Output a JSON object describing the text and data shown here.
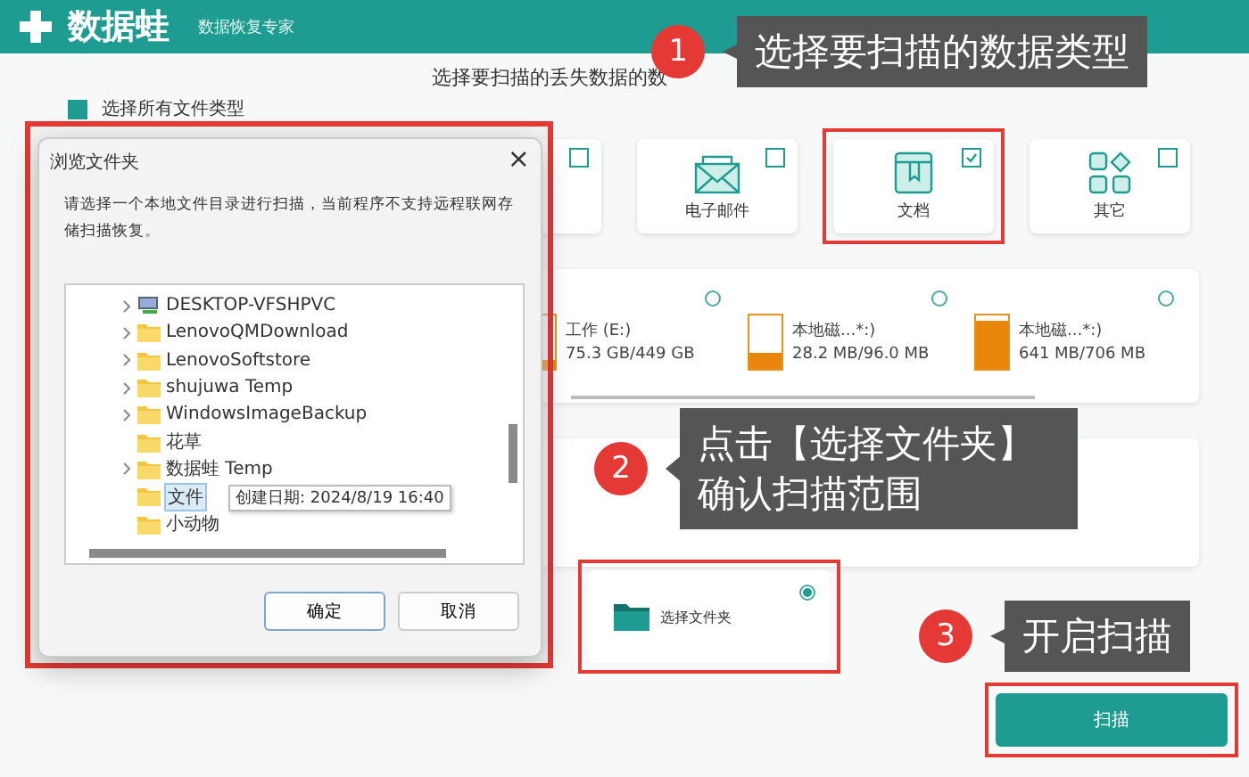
{
  "app": {
    "name": "数据蛙",
    "subtitle": "数据恢复专家"
  },
  "heading": "选择要扫描的丢失数据的数",
  "select_all": {
    "label": "选择所有文件类型",
    "checked": true
  },
  "file_types": [
    {
      "checked": false,
      "highlighted": false
    },
    {
      "label": "电子邮件",
      "kind": "mail",
      "checked": false,
      "highlighted": false
    },
    {
      "label": "文档",
      "kind": "document",
      "checked": true,
      "highlighted": true
    },
    {
      "label": "其它",
      "kind": "other",
      "checked": false,
      "highlighted": false
    }
  ],
  "drives": [
    {
      "name": "工作 (E:)",
      "usage": "75.3 GB/449 GB",
      "level": 0.17,
      "selected": false
    },
    {
      "name": "本地磁...*:)",
      "usage": "28.2 MB/96.0 MB",
      "level": 0.3,
      "selected": false
    },
    {
      "name": "本地磁...*:)",
      "usage": "641 MB/706 MB",
      "level": 0.9,
      "selected": false
    }
  ],
  "folder_option": {
    "label": "选择文件夹",
    "selected": true,
    "highlighted": true
  },
  "scan_button": {
    "label": "扫描",
    "highlighted": true
  },
  "dialog": {
    "title": "浏览文件夹",
    "close": "×",
    "message": "请选择一个本地文件目录进行扫描，当前程序不支持远程联网存储扫描恢复。",
    "tree": [
      {
        "label": "DESKTOP-VFSHPVC",
        "kind": "computer",
        "expandable": true,
        "selected": false
      },
      {
        "label": "LenovoQMDownload",
        "kind": "folder",
        "expandable": true,
        "selected": false
      },
      {
        "label": "LenovoSoftstore",
        "kind": "folder",
        "expandable": true,
        "selected": false
      },
      {
        "label": "shujuwa Temp",
        "kind": "folder",
        "expandable": true,
        "selected": false
      },
      {
        "label": "WindowsImageBackup",
        "kind": "folder",
        "expandable": true,
        "selected": false
      },
      {
        "label": "花草",
        "kind": "folder",
        "expandable": false,
        "selected": false
      },
      {
        "label": "数据蛙 Temp",
        "kind": "folder",
        "expandable": true,
        "selected": false
      },
      {
        "label": "文件",
        "kind": "folder",
        "expandable": false,
        "selected": true
      },
      {
        "label": "小动物",
        "kind": "folder",
        "expandable": false,
        "selected": false
      }
    ],
    "tooltip": "创建日期: 2024/8/19 16:40",
    "buttons": [
      "确定",
      "取消"
    ],
    "highlighted": true
  },
  "callouts": [
    {
      "number": "1",
      "lines": [
        "选择要扫描的数据类型"
      ]
    },
    {
      "number": "2",
      "lines": [
        "点击【选择文件夹】",
        "确认扫描范围"
      ]
    },
    {
      "number": "3",
      "lines": [
        "开启扫描"
      ]
    }
  ]
}
